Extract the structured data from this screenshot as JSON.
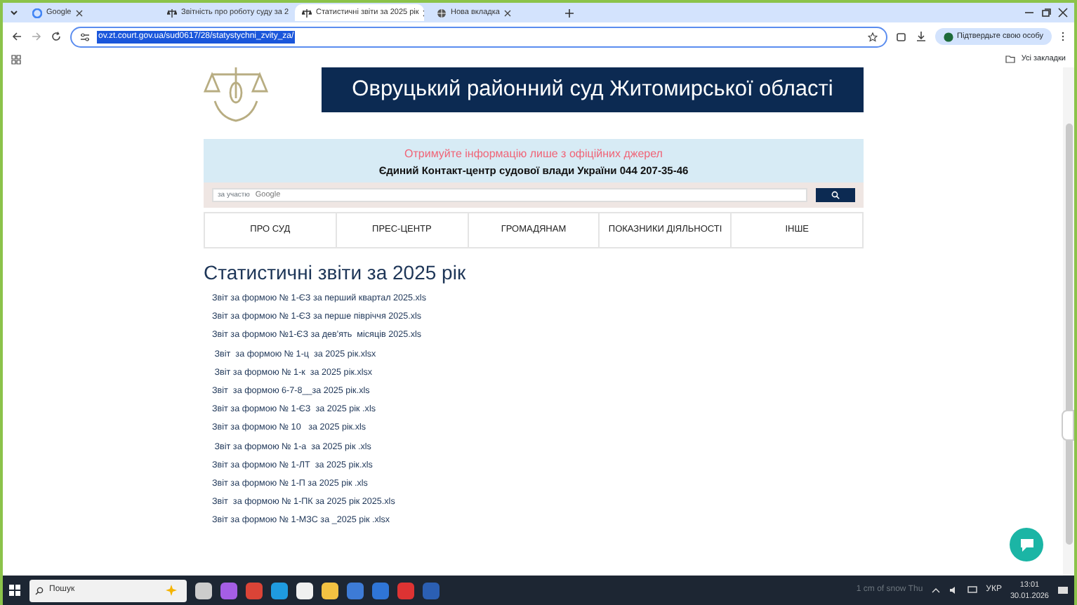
{
  "browser": {
    "tabs": [
      {
        "title": "Google",
        "kind": "google",
        "selected": false
      },
      {
        "title": "Звітність про роботу суду за 2",
        "kind": "court",
        "selected": false
      },
      {
        "title": "Статистичні звіти за 2025 рік",
        "kind": "court",
        "selected": true
      },
      {
        "title": "Нова вкладка",
        "kind": "newtab",
        "selected": false
      }
    ],
    "url": "ov.zt.court.gov.ua/sud0617/28/statystychni_zvity_za/",
    "profile": "Підтвердьте свою особу",
    "bookmarks": "Усі закладки"
  },
  "site": {
    "court_name": "Овруцький районний суд Житомирської області",
    "notice": "Отримуйте інформацію лише з офіційних джерел",
    "contact": "Єдиний Контакт-центр судової влади України 044 207-35-46",
    "search": {
      "placeholder": "Google",
      "label": "за участю"
    },
    "nav": [
      "ПРО СУД",
      "ПРЕС-ЦЕНТР",
      "ГРОМАДЯНАМ",
      "ПОКАЗНИКИ ДІЯЛЬНОСТІ",
      "ІНШЕ"
    ],
    "heading": "Статистичні звіти за 2025 рік",
    "reports": [
      "Звіт за формою № 1-ЄЗ за перший квартал 2025.xls",
      "Звіт за формою № 1-ЄЗ за перше півріччя 2025.xls",
      "Звіт за формою №1-ЄЗ за дев'ять  місяців 2025.xls",
      " Звіт  за формою № 1-ц  за 2025 рік.xlsx",
      " Звіт за формою № 1-к  за 2025 рік.xlsx",
      "Звіт  за формою 6-7-8__за 2025 рік.xls",
      "Звіт за формою № 1-ЄЗ  за 2025 рік .xls",
      "Звіт за формою № 10   за 2025 рік.xls",
      " Звіт за формою № 1-а  за 2025 рік .xls",
      "Звіт за формою № 1-ЛТ  за 2025 рік.xls",
      "Звіт за формою № 1-П за 2025 рік .xls",
      "Звіт  за формою № 1-ПК за 2025 рік 2025.xls",
      "Звіт за формою № 1-МЗС за _2025 рік .xlsx"
    ]
  },
  "taskbar": {
    "search_placeholder": "Пошук",
    "weather": "1 cm of snow Thu",
    "language": "УКР",
    "time": "13:01",
    "date": "30.01.2026"
  }
}
